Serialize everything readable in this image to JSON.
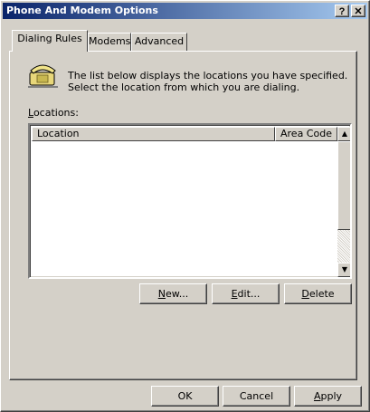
{
  "window": {
    "title": "Phone And Modem Options",
    "help_label": "?",
    "close_label": "✕"
  },
  "tabs": [
    {
      "label": "Dialing Rules",
      "active": true
    },
    {
      "label": "Modems",
      "active": false
    },
    {
      "label": "Advanced",
      "active": false
    }
  ],
  "dialing_rules": {
    "description": "The list below displays the locations you have specified. Select the location from which you are dialing.",
    "locations_label_first": "L",
    "locations_label_rest": "ocations:",
    "columns": [
      "Location",
      "Area Code"
    ],
    "rows": [],
    "buttons": {
      "new_first": "N",
      "new_rest": "ew...",
      "edit_first": "E",
      "edit_rest": "dit...",
      "delete_first": "D",
      "delete_rest": "elete"
    }
  },
  "footer": {
    "ok_label": "OK",
    "cancel_label": "Cancel",
    "apply_first": "A",
    "apply_rest": "pply"
  },
  "icons": {
    "phone": "phone-icon",
    "scroll_up": "scroll-up-icon",
    "scroll_down": "scroll-down-icon"
  },
  "colors": {
    "face": "#d4d0c8",
    "title_start": "#0a246a",
    "title_end": "#a6caf0"
  }
}
